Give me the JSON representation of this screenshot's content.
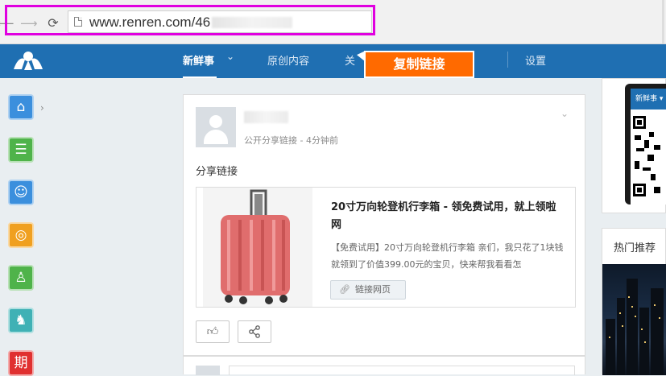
{
  "browser": {
    "url": "www.renren.com/46",
    "nav_back": "⟵",
    "nav_forward": "⟶",
    "reload": "⟳"
  },
  "header": {
    "nav": [
      {
        "label": "新鲜事",
        "active": true
      },
      {
        "label": "原创内容",
        "active": false
      },
      {
        "label": "关",
        "active": false
      },
      {
        "label": "设置",
        "active": false
      }
    ],
    "copy_link_label": "复制链接",
    "brand_color": "#1f6fb2",
    "accent_color": "#ff6a00"
  },
  "sidebar": {
    "items": [
      {
        "icon": "home-icon",
        "color": "#3b8fdd"
      },
      {
        "icon": "profile-card-icon",
        "color": "#4fb34a"
      },
      {
        "icon": "person-icon",
        "color": "#3b8fdd"
      },
      {
        "icon": "apps-icon",
        "color": "#f0a020"
      },
      {
        "icon": "friends-icon",
        "color": "#4fb34a"
      },
      {
        "icon": "game-icon",
        "color": "#3fb1b5"
      },
      {
        "icon": "calendar-icon",
        "color": "#e03030",
        "glyph": "期"
      }
    ]
  },
  "feed": {
    "post": {
      "meta": "公开分享链接 - 4分钟前",
      "text": "分享链接",
      "link": {
        "title": "20寸万向轮登机行李箱 - 领免费试用，就上领啦网",
        "description": "【免费试用】20寸万向轮登机行李箱 亲们，我只花了1块钱就领到了价值399.00元的宝贝，快来帮我看看怎",
        "button_label": "链接网页"
      }
    }
  },
  "right": {
    "phone_header": "新鲜事 ▾",
    "hot_title": "热门推荐"
  }
}
